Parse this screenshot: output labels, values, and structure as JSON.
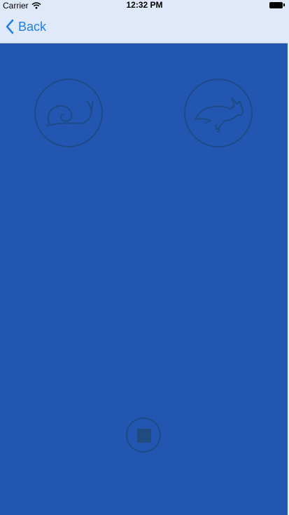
{
  "status_bar": {
    "carrier": "Carrier",
    "time": "12:32 PM",
    "wifi_icon": "wifi-icon",
    "battery_icon": "battery-icon"
  },
  "nav": {
    "back_label": "Back",
    "back_icon": "chevron-left-icon"
  },
  "controls": {
    "slow_icon": "snail-icon",
    "fast_icon": "rabbit-icon",
    "stop_icon": "stop-icon"
  },
  "colors": {
    "background": "#2356b0",
    "bar": "#e0e9f9",
    "accent": "#1f7ee8",
    "control_stroke": "#1e4a87"
  }
}
